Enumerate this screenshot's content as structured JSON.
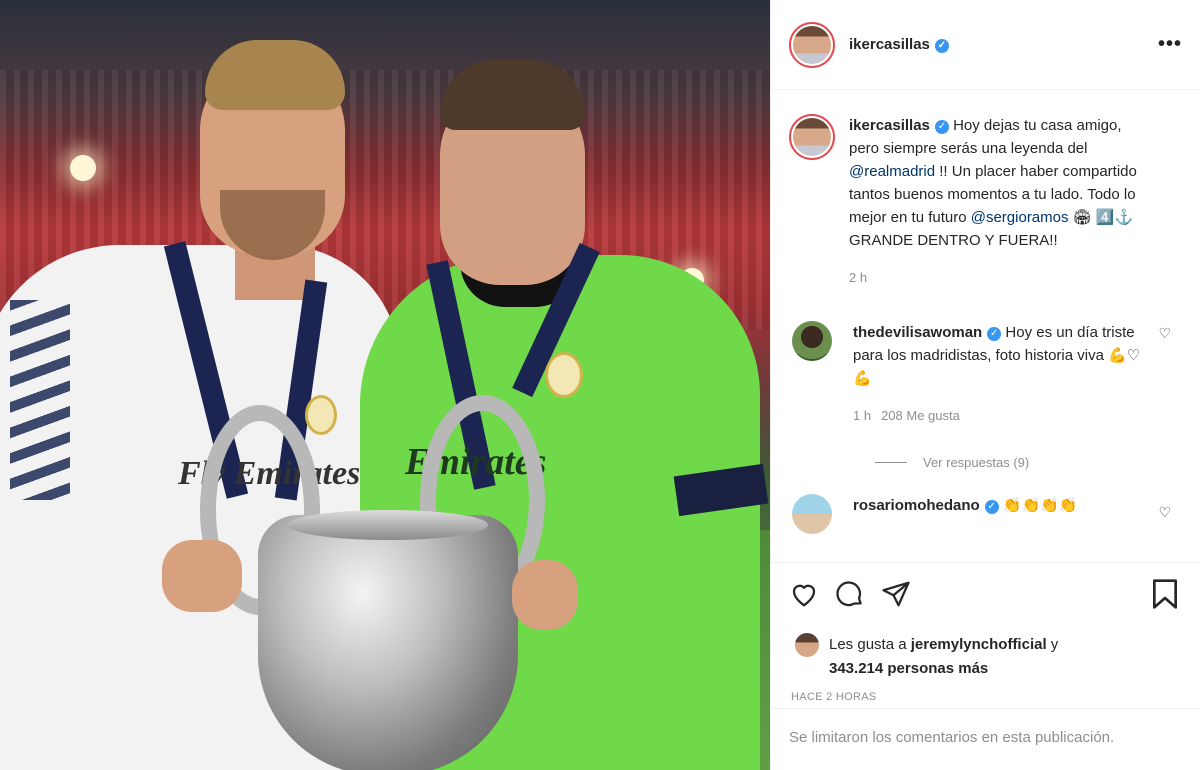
{
  "post": {
    "username": "ikercasillas",
    "more_icon": "more-horizontal-icon"
  },
  "caption": {
    "username": "ikercasillas",
    "text_1": "Hoy dejas tu casa amigo, pero siempre serás una leyenda del ",
    "mention_1": "@realmadrid",
    "text_2": " !! Un placer haber compartido tantos buenos momentos a tu lado. Todo lo mejor en tu futuro ",
    "mention_2": "@sergioramos",
    "emoji": " 🏟 4️⃣⚓ ",
    "text_3": "GRANDE DENTRO Y FUERA!!",
    "time": "2 h"
  },
  "comments": [
    {
      "username": "thedevilisawoman",
      "text": "Hoy es un día triste para los madridistas, foto historia viva 💪♡💪",
      "time": "1 h",
      "likes": "208 Me gusta",
      "replies": "Ver respuestas (9)"
    },
    {
      "username": "rosariomohedano",
      "text": "👏👏👏👏"
    }
  ],
  "actions": {
    "liked_by_prefix": "Les gusta a ",
    "liked_by_user": "jeremylynchofficial",
    "liked_by_suffix": " y",
    "liked_count": "343.214 personas más",
    "posted_ago": "HACE 2 HORAS",
    "comments_limited": "Se limitaron los comentarios en esta publicación."
  },
  "photo": {
    "sponsor_1": "Fly Emirates",
    "sponsor_2": "Emirates"
  },
  "colors": {
    "verified": "#3897f0",
    "mention": "#003569",
    "muted": "#8e8e8e",
    "story_ring": "#e44b52"
  }
}
